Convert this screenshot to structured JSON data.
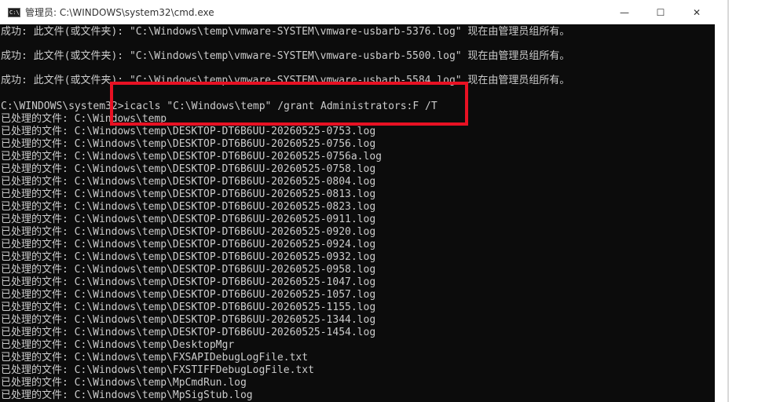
{
  "window": {
    "title": "管理员: C:\\WINDOWS\\system32\\cmd.exe",
    "icon": "cmd-icon",
    "controls": {
      "minimize": "—",
      "maximize": "☐",
      "close": "✕"
    }
  },
  "console": {
    "success_lines": [
      "成功: 此文件(或文件夹): \"C:\\Windows\\temp\\vmware-SYSTEM\\vmware-usbarb-5376.log\" 现在由管理员组所有。",
      "成功: 此文件(或文件夹): \"C:\\Windows\\temp\\vmware-SYSTEM\\vmware-usbarb-5500.log\" 现在由管理员组所有。",
      "成功: 此文件(或文件夹): \"C:\\Windows\\temp\\vmware-SYSTEM\\vmware-usbarb-5584.log\" 现在由管理员组所有。"
    ],
    "command_line": "C:\\WINDOWS\\system32>icacls \"C:\\Windows\\temp\" /grant Administrators:F /T",
    "processed_lines": [
      "已处理的文件: C:\\Windows\\temp",
      "已处理的文件: C:\\Windows\\temp\\DESKTOP-DT6B6UU-20260525-0753.log",
      "已处理的文件: C:\\Windows\\temp\\DESKTOP-DT6B6UU-20260525-0756.log",
      "已处理的文件: C:\\Windows\\temp\\DESKTOP-DT6B6UU-20260525-0756a.log",
      "已处理的文件: C:\\Windows\\temp\\DESKTOP-DT6B6UU-20260525-0758.log",
      "已处理的文件: C:\\Windows\\temp\\DESKTOP-DT6B6UU-20260525-0804.log",
      "已处理的文件: C:\\Windows\\temp\\DESKTOP-DT6B6UU-20260525-0813.log",
      "已处理的文件: C:\\Windows\\temp\\DESKTOP-DT6B6UU-20260525-0823.log",
      "已处理的文件: C:\\Windows\\temp\\DESKTOP-DT6B6UU-20260525-0911.log",
      "已处理的文件: C:\\Windows\\temp\\DESKTOP-DT6B6UU-20260525-0920.log",
      "已处理的文件: C:\\Windows\\temp\\DESKTOP-DT6B6UU-20260525-0924.log",
      "已处理的文件: C:\\Windows\\temp\\DESKTOP-DT6B6UU-20260525-0932.log",
      "已处理的文件: C:\\Windows\\temp\\DESKTOP-DT6B6UU-20260525-0958.log",
      "已处理的文件: C:\\Windows\\temp\\DESKTOP-DT6B6UU-20260525-1047.log",
      "已处理的文件: C:\\Windows\\temp\\DESKTOP-DT6B6UU-20260525-1057.log",
      "已处理的文件: C:\\Windows\\temp\\DESKTOP-DT6B6UU-20260525-1155.log",
      "已处理的文件: C:\\Windows\\temp\\DESKTOP-DT6B6UU-20260525-1344.log",
      "已处理的文件: C:\\Windows\\temp\\DESKTOP-DT6B6UU-20260525-1454.log",
      "已处理的文件: C:\\Windows\\temp\\DesktopMgr",
      "已处理的文件: C:\\Windows\\temp\\FXSAPIDebugLogFile.txt",
      "已处理的文件: C:\\Windows\\temp\\FXSTIFFDebugLogFile.txt",
      "已处理的文件: C:\\Windows\\temp\\MpCmdRun.log",
      "已处理的文件: C:\\Windows\\temp\\MpSigStub.log"
    ]
  },
  "colors": {
    "console_bg": "#0c0c0c",
    "console_text": "#cccccc",
    "highlight": "#e81123"
  }
}
